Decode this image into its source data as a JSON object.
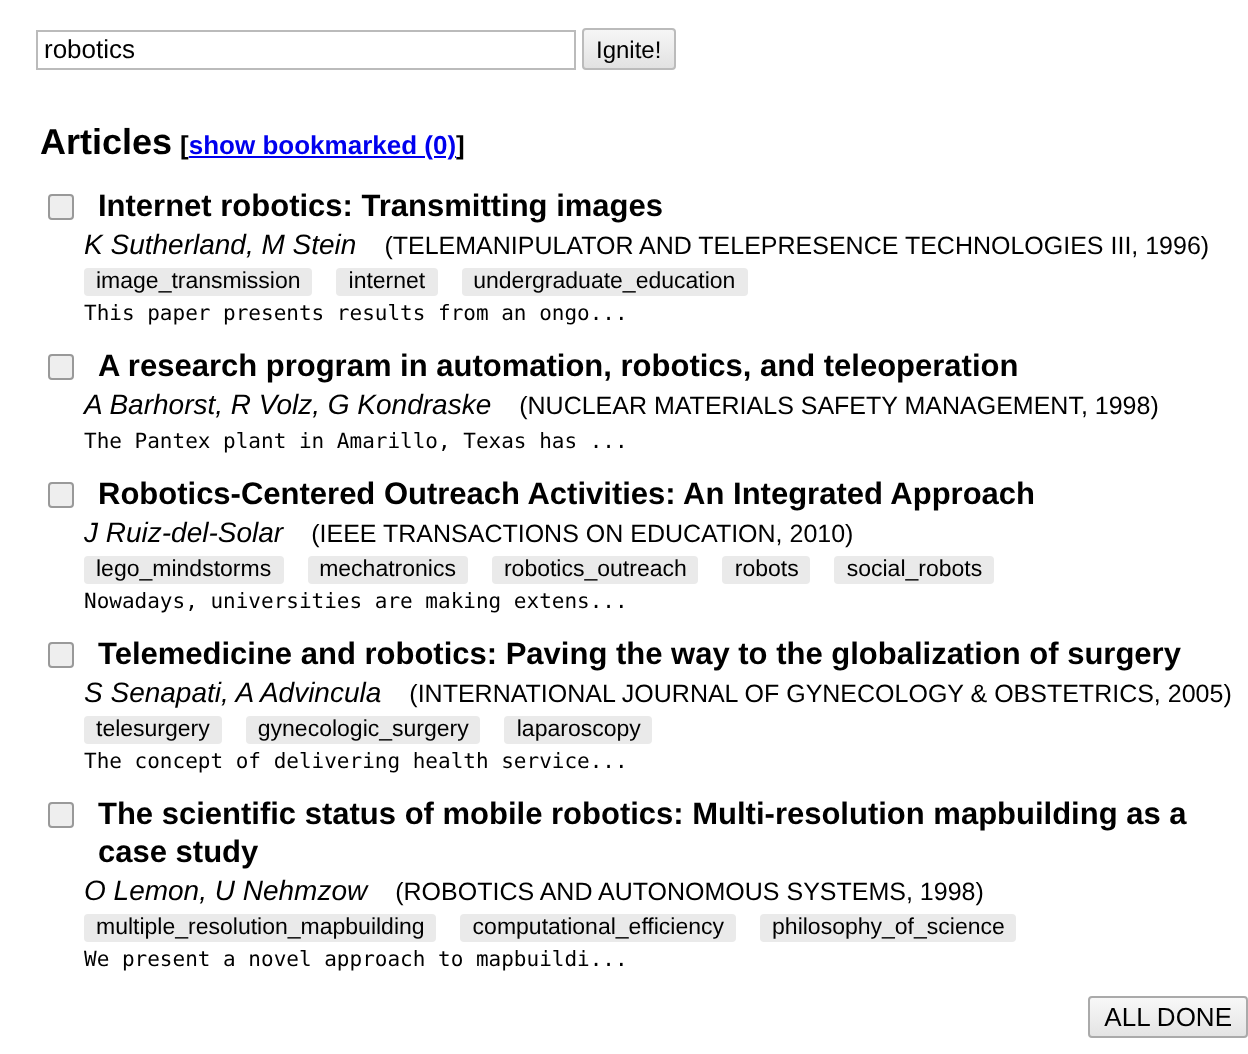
{
  "search": {
    "value": "robotics",
    "button": "Ignite!"
  },
  "heading": {
    "title": "Articles",
    "open": "[",
    "link": "show bookmarked (0)",
    "close": "]"
  },
  "articles": [
    {
      "checked": false,
      "title": "Internet robotics: Transmitting images",
      "authors": "K Sutherland, M Stein",
      "venue": "(TELEMANIPULATOR AND TELEPRESENCE TECHNOLOGIES III, 1996)",
      "tags": [
        "image_transmission",
        "internet",
        "undergraduate_education"
      ],
      "snippet": "This paper presents results from an ongo..."
    },
    {
      "checked": false,
      "title": "A research program in automation, robotics, and teleoperation",
      "authors": "A Barhorst, R Volz, G Kondraske",
      "venue": "(NUCLEAR MATERIALS SAFETY MANAGEMENT, 1998)",
      "snippet": "The Pantex plant in Amarillo, Texas has ..."
    },
    {
      "checked": false,
      "title": "Robotics-Centered Outreach Activities: An Integrated Approach",
      "authors": "J Ruiz-del-Solar",
      "venue": "(IEEE TRANSACTIONS ON EDUCATION, 2010)",
      "tags": [
        "lego_mindstorms",
        "mechatronics",
        "robotics_outreach",
        "robots",
        "social_robots"
      ],
      "snippet": "Nowadays, universities are making extens..."
    },
    {
      "checked": false,
      "title": "Telemedicine and robotics: Paving the way to the globalization of surgery",
      "authors": "S Senapati, A Advincula",
      "venue": "(INTERNATIONAL JOURNAL OF GYNECOLOGY & OBSTETRICS, 2005)",
      "tags": [
        "telesurgery",
        "gynecologic_surgery",
        "laparoscopy"
      ],
      "snippet": "The concept of delivering health service..."
    },
    {
      "checked": false,
      "title": "The scientific status of mobile robotics: Multi-resolution mapbuilding as a case study",
      "authors": "O Lemon, U Nehmzow",
      "venue": "(ROBOTICS AND AUTONOMOUS SYSTEMS, 1998)",
      "tags": [
        "multiple_resolution_mapbuilding",
        "computational_efficiency",
        "philosophy_of_science"
      ],
      "snippet": "We present a novel approach to mapbuildi..."
    }
  ],
  "done_button": "ALL DONE"
}
